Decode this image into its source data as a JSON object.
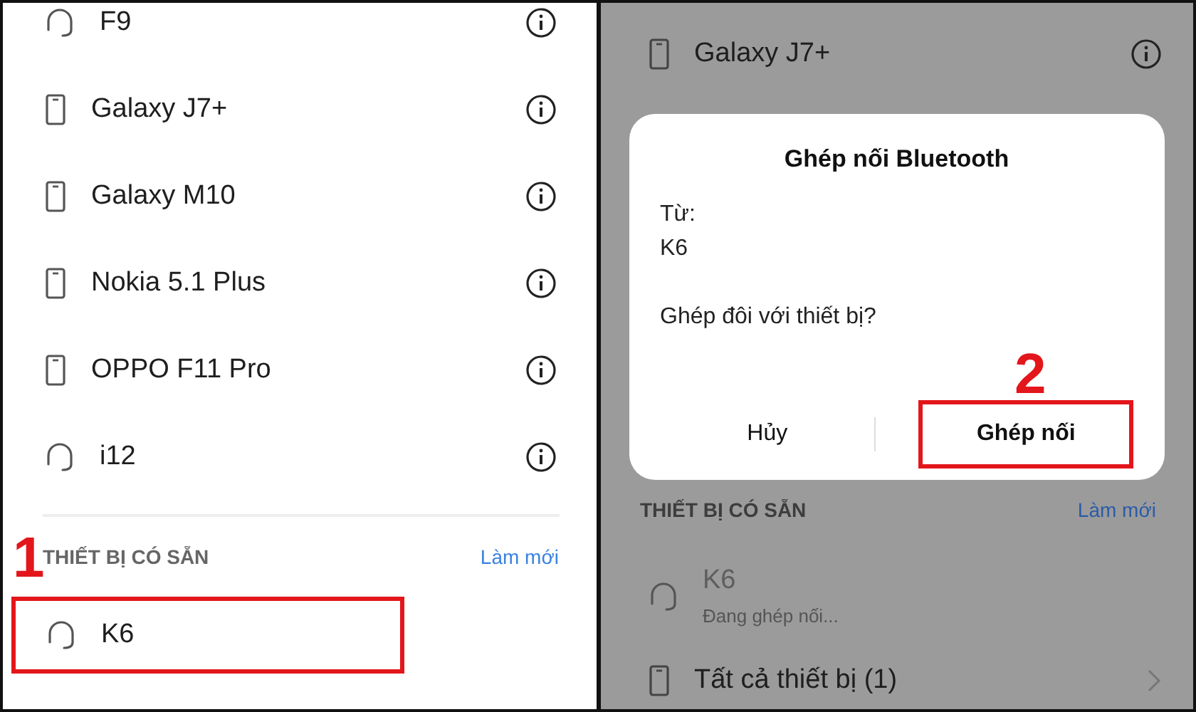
{
  "left_screen": {
    "devices": [
      {
        "name": "F9",
        "kind": "headset"
      },
      {
        "name": "Galaxy J7+",
        "kind": "phone"
      },
      {
        "name": "Galaxy M10",
        "kind": "phone"
      },
      {
        "name": "Nokia 5.1 Plus",
        "kind": "phone"
      },
      {
        "name": "OPPO F11 Pro",
        "kind": "phone"
      },
      {
        "name": "i12",
        "kind": "headset"
      }
    ],
    "section_title": "THIẾT BỊ CÓ SẴN",
    "refresh": "Làm mới",
    "step": "1",
    "available": [
      {
        "name": "K6",
        "kind": "headset",
        "highlighted": true
      }
    ]
  },
  "right_screen": {
    "devices": [
      {
        "name": "Galaxy J7+",
        "kind": "phone"
      }
    ],
    "dialog": {
      "title": "Ghép nối Bluetooth",
      "from_label": "Từ:",
      "from_value": "K6",
      "question": "Ghép đôi với thiết bị?",
      "step": "2",
      "buttons": [
        {
          "label": "Hủy",
          "highlighted": false
        },
        {
          "label": "Ghép nối",
          "highlighted": true
        }
      ]
    },
    "section_title": "THIẾT BỊ CÓ SẴN",
    "refresh": "Làm mới",
    "available": [
      {
        "name": "K6",
        "kind": "headset",
        "status": "Đang ghép nối...",
        "disabled": true
      }
    ],
    "all_devices": "Tất cả thiết bị (1)"
  }
}
